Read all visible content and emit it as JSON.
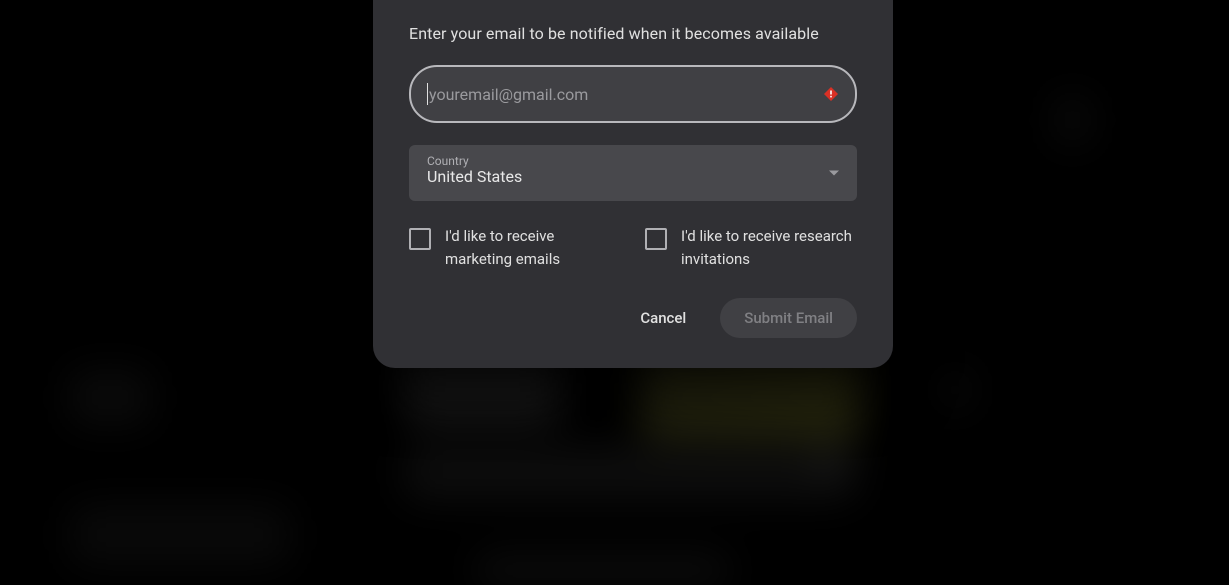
{
  "dialog": {
    "prompt": "Enter your email to be notified when it becomes available",
    "email": {
      "placeholder": "youremail@gmail.com",
      "value": "",
      "error_icon": "error-diamond-icon"
    },
    "country": {
      "label": "Country",
      "value": "United States"
    },
    "checkboxes": {
      "marketing": {
        "label": "I'd like to receive marketing emails",
        "checked": false
      },
      "research": {
        "label": "I'd like to receive research invitations",
        "checked": false
      }
    },
    "actions": {
      "cancel_label": "Cancel",
      "submit_label": "Submit Email",
      "submit_disabled": true
    },
    "colors": {
      "dialog_bg": "#303034",
      "input_bg": "#404044",
      "input_border": "#b8b8bc",
      "select_bg": "#48484c",
      "error": "#d93025",
      "text_primary": "#e0e0e0",
      "text_secondary": "#9a9a9e",
      "submit_disabled_bg": "#404044",
      "submit_disabled_text": "#808084"
    }
  }
}
